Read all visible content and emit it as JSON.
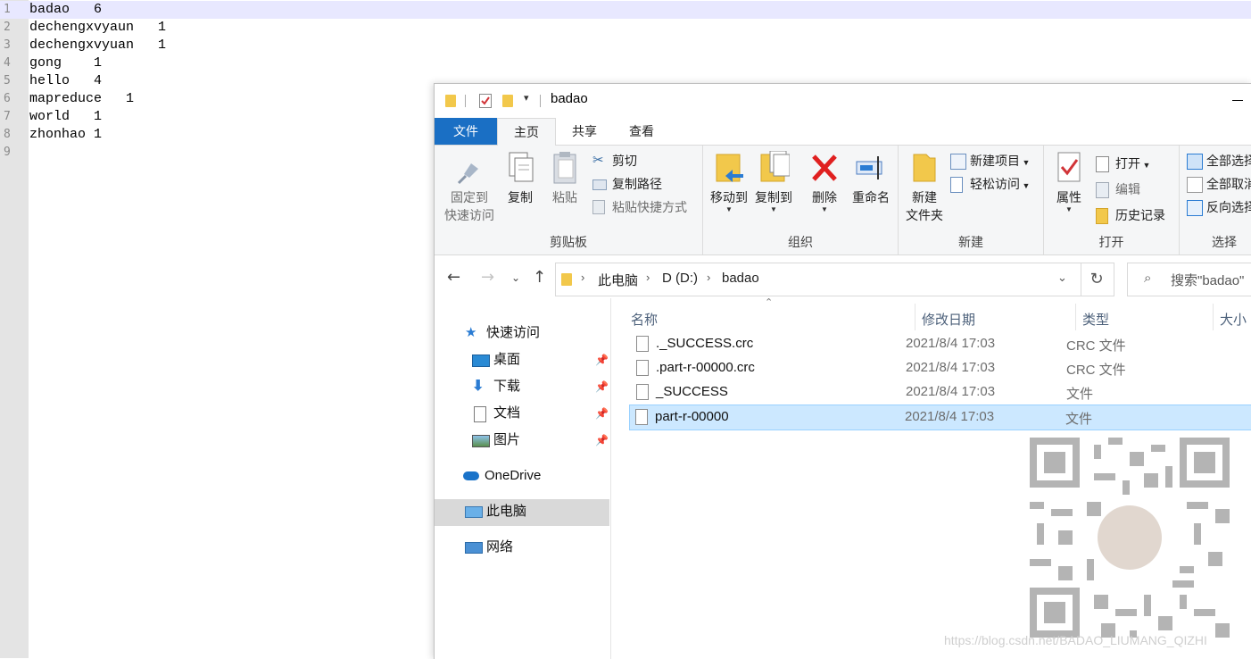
{
  "editor": {
    "lines": [
      {
        "n": "1",
        "text": "badao   6"
      },
      {
        "n": "2",
        "text": "dechengxvyaun   1"
      },
      {
        "n": "3",
        "text": "dechengxvyuan   1"
      },
      {
        "n": "4",
        "text": "gong    1"
      },
      {
        "n": "5",
        "text": "hello   4"
      },
      {
        "n": "6",
        "text": "mapreduce   1"
      },
      {
        "n": "7",
        "text": "world   1"
      },
      {
        "n": "8",
        "text": "zhonhao 1"
      },
      {
        "n": "9",
        "text": ""
      }
    ]
  },
  "explorer": {
    "title": "badao",
    "tabs": {
      "file": "文件",
      "home": "主页",
      "share": "共享",
      "view": "查看"
    },
    "ribbon": {
      "clipboard": {
        "label": "剪贴板",
        "pin_line1": "固定到",
        "pin_line2": "快速访问",
        "copy": "复制",
        "paste": "粘贴",
        "cut": "剪切",
        "copy_path": "复制路径",
        "paste_shortcut": "粘贴快捷方式"
      },
      "organize": {
        "label": "组织",
        "move_to": "移动到",
        "copy_to": "复制到",
        "delete": "删除",
        "rename": "重命名"
      },
      "new": {
        "label": "新建",
        "new_folder_line1": "新建",
        "new_folder_line2": "文件夹",
        "new_item": "新建项目",
        "easy_access": "轻松访问"
      },
      "open": {
        "label": "打开",
        "properties": "属性",
        "open": "打开",
        "edit": "编辑",
        "history": "历史记录"
      },
      "select": {
        "label": "选择",
        "select_all": "全部选择",
        "select_none": "全部取消",
        "invert": "反向选择"
      }
    },
    "address": {
      "crumbs": [
        "此电脑",
        "D (D:)",
        "badao"
      ],
      "search_placeholder": "搜索\"badao\""
    },
    "nav": {
      "quick_access": "快速访问",
      "desktop": "桌面",
      "downloads": "下载",
      "documents": "文档",
      "pictures": "图片",
      "onedrive": "OneDrive",
      "this_pc": "此电脑",
      "network": "网络"
    },
    "columns": {
      "name": "名称",
      "date": "修改日期",
      "type": "类型",
      "size": "大小"
    },
    "files": [
      {
        "name": "._SUCCESS.crc",
        "date": "2021/8/4 17:03",
        "type": "CRC 文件"
      },
      {
        "name": ".part-r-00000.crc",
        "date": "2021/8/4 17:03",
        "type": "CRC 文件"
      },
      {
        "name": "_SUCCESS",
        "date": "2021/8/4 17:03",
        "type": "文件"
      },
      {
        "name": "part-r-00000",
        "date": "2021/8/4 17:03",
        "type": "文件"
      }
    ]
  },
  "watermark": "https://blog.csdn.net/BADAO_LIUMANG_QIZHI",
  "colors": {
    "accent": "#1a6fc4",
    "selection": "#cce8ff",
    "gutter": "#e4e4e4",
    "current_line": "#e8e8ff"
  }
}
